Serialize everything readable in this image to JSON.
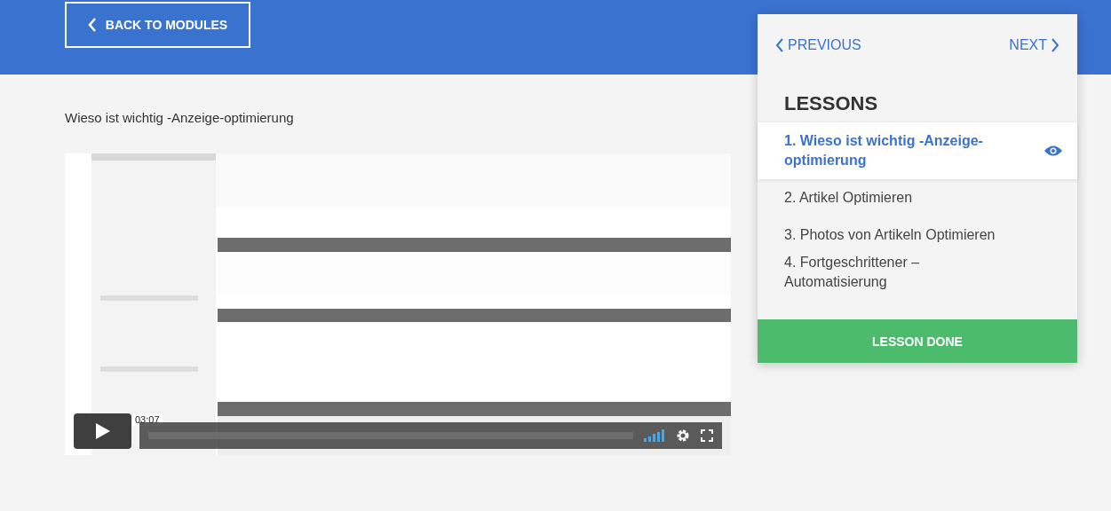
{
  "back_button": {
    "label": "BACK TO MODULES"
  },
  "lesson_title": "Wieso ist wichtig -Anzeige-optimierung",
  "video": {
    "kind": "picture",
    "time": "03:07"
  },
  "nav": {
    "previous": "PREVIOUS",
    "next": "NEXT"
  },
  "lessons": {
    "heading": "LESSONS",
    "items": [
      {
        "label": "1. Wieso ist wichtig -Anzeige-optimierung",
        "selected": true
      },
      {
        "label": "2. Artikel Optimieren",
        "selected": false
      },
      {
        "label": "3. Photos von Artikeln Optimieren",
        "selected": false
      },
      {
        "label": "4. Fortgeschrittener – Automatisierung",
        "selected": false
      }
    ]
  },
  "done_button": {
    "label": "LESSON DONE"
  }
}
